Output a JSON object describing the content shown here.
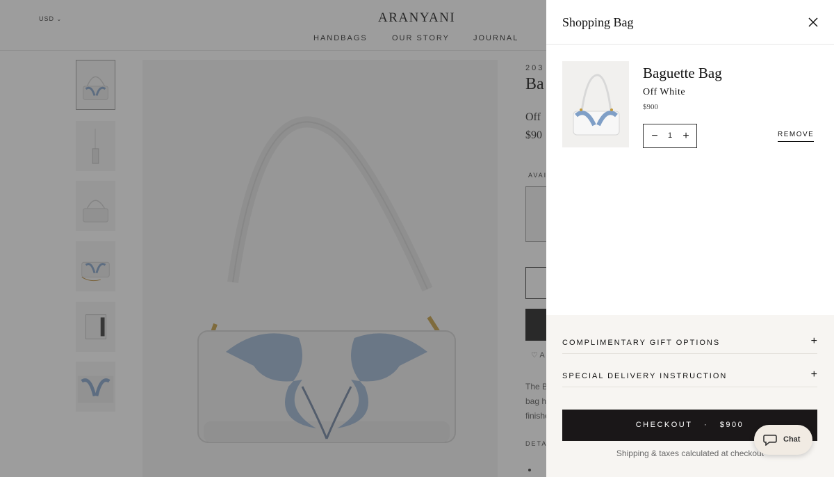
{
  "header": {
    "currency": "USD",
    "logo": "ARANYANI",
    "nav": [
      "HANDBAGS",
      "OUR STORY",
      "JOURNAL"
    ]
  },
  "product": {
    "code_visible": "203",
    "title_visible": "Ba",
    "color_visible": "Off",
    "price_visible": "$90",
    "availability_visible": "AVAI",
    "description_visible": [
      "The B",
      "bag ha",
      "finishe"
    ],
    "details_visible": "DETA",
    "wishlist_visible": "A"
  },
  "drawer": {
    "title": "Shopping Bag",
    "item": {
      "name": "Baguette Bag",
      "variant": "Off White",
      "price": "$900",
      "quantity": "1",
      "remove_label": "REMOVE"
    },
    "options": [
      {
        "label": "COMPLIMENTARY GIFT OPTIONS"
      },
      {
        "label": "SPECIAL DELIVERY INSTRUCTION"
      }
    ],
    "checkout": {
      "label": "CHECKOUT",
      "separator": "·",
      "total": "$900"
    },
    "checkout_note": "Shipping & taxes calculated at checkout"
  },
  "chat": {
    "label": "Chat"
  },
  "colors": {
    "overlay": "#3c3c3c",
    "checkout_bg": "#1a1718",
    "footer_bg": "#f7f5f2",
    "chat_bg": "#f1ebe3",
    "embroidery": "#7f9fc7"
  },
  "icons": {
    "currency": "chevron-down-icon",
    "close": "close-icon",
    "minus": "minus-icon",
    "plus": "plus-icon",
    "chat": "chat-bubble-icon",
    "wishlist": "heart-icon"
  }
}
